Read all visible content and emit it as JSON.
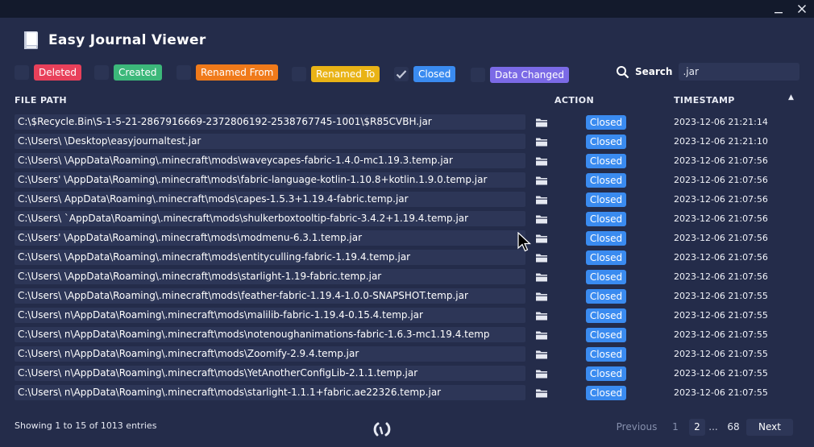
{
  "window": {
    "minimize_glyph": "—",
    "close_glyph": "✕"
  },
  "header": {
    "icon": "book-icon",
    "title": "Easy Journal Viewer"
  },
  "filters": [
    {
      "label": "Deleted",
      "checked": false,
      "color": "#e8405a"
    },
    {
      "label": "Created",
      "checked": false,
      "color": "#3cb87a"
    },
    {
      "label": "Renamed From",
      "checked": false,
      "color": "#f07a1a"
    },
    {
      "label": "Renamed To",
      "checked": false,
      "color": "#e9b316"
    },
    {
      "label": "Closed",
      "checked": true,
      "color": "#3a8bf0"
    },
    {
      "label": "Data Changed",
      "checked": false,
      "color": "#7b6ae6"
    }
  ],
  "search": {
    "label": "Search",
    "value": ".jar"
  },
  "table": {
    "headers": {
      "file_path": "FILE PATH",
      "action": "ACTION",
      "timestamp": "TIMESTAMP"
    },
    "sort_indicator": "▲",
    "rows": [
      {
        "path": "C:\\$Recycle.Bin\\S-1-5-21-2867916669-2372806192-2538767745-1001\\$R85CVBH.jar",
        "action": "Closed",
        "timestamp": "2023-12-06 21:21:14"
      },
      {
        "path": "C:\\Users\\            \\Desktop\\easyjournaltest.jar",
        "action": "Closed",
        "timestamp": "2023-12-06 21:21:10"
      },
      {
        "path": "C:\\Users\\            \\AppData\\Roaming\\.minecraft\\mods\\waveycapes-fabric-1.4.0-mc1.19.3.temp.jar",
        "action": "Closed",
        "timestamp": "2023-12-06 21:07:56"
      },
      {
        "path": "C:\\Users'            \\AppData\\Roaming\\.minecraft\\mods\\fabric-language-kotlin-1.10.8+kotlin.1.9.0.temp.jar",
        "action": "Closed",
        "timestamp": "2023-12-06 21:07:56"
      },
      {
        "path": "C:\\Users\\             AppData\\Roaming\\.minecraft\\mods\\capes-1.5.3+1.19.4-fabric.temp.jar",
        "action": "Closed",
        "timestamp": "2023-12-06 21:07:56"
      },
      {
        "path": "C:\\Users\\            `AppData\\Roaming\\.minecraft\\mods\\shulkerboxtooltip-fabric-3.4.2+1.19.4.temp.jar",
        "action": "Closed",
        "timestamp": "2023-12-06 21:07:56"
      },
      {
        "path": "C:\\Users'            \\AppData\\Roaming\\.minecraft\\mods\\modmenu-6.3.1.temp.jar",
        "action": "Closed",
        "timestamp": "2023-12-06 21:07:56"
      },
      {
        "path": "C:\\Users\\            \\AppData\\Roaming\\.minecraft\\mods\\entityculling-fabric-1.19.4.temp.jar",
        "action": "Closed",
        "timestamp": "2023-12-06 21:07:56"
      },
      {
        "path": "C:\\Users\\            \\AppData\\Roaming\\.minecraft\\mods\\starlight-1.19-fabric.temp.jar",
        "action": "Closed",
        "timestamp": "2023-12-06 21:07:56"
      },
      {
        "path": "C:\\Users\\            \\AppData\\Roaming\\.minecraft\\mods\\feather-fabric-1.19.4-1.0.0-SNAPSHOT.temp.jar",
        "action": "Closed",
        "timestamp": "2023-12-06 21:07:55"
      },
      {
        "path": "C:\\Users\\          n\\AppData\\Roaming\\.minecraft\\mods\\malilib-fabric-1.19.4-0.15.4.temp.jar",
        "action": "Closed",
        "timestamp": "2023-12-06 21:07:55"
      },
      {
        "path": "C:\\Users\\          n\\AppData\\Roaming\\.minecraft\\mods\\notenoughanimations-fabric-1.6.3-mc1.19.4.temp",
        "action": "Closed",
        "timestamp": "2023-12-06 21:07:55"
      },
      {
        "path": "C:\\Users\\          n\\AppData\\Roaming\\.minecraft\\mods\\Zoomify-2.9.4.temp.jar",
        "action": "Closed",
        "timestamp": "2023-12-06 21:07:55"
      },
      {
        "path": "C:\\Users\\          n\\AppData\\Roaming\\.minecraft\\mods\\YetAnotherConfigLib-2.1.1.temp.jar",
        "action": "Closed",
        "timestamp": "2023-12-06 21:07:55"
      },
      {
        "path": "C:\\Users\\          n\\AppData\\Roaming\\.minecraft\\mods\\starlight-1.1.1+fabric.ae22326.temp.jar",
        "action": "Closed",
        "timestamp": "2023-12-06 21:07:55"
      }
    ]
  },
  "footer": {
    "info": "Showing 1 to 15 of 1013 entries",
    "pagination": {
      "previous": "Previous",
      "pages": [
        "1",
        "2"
      ],
      "ellipsis": "...",
      "last": "68",
      "next": "Next",
      "current": "2"
    }
  }
}
